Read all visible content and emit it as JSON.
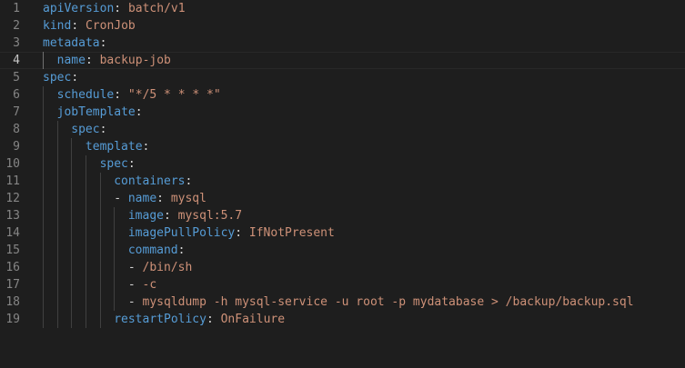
{
  "lines": [
    {
      "n": "1",
      "dash": "",
      "key": "apiVersion",
      "value": "batch/v1"
    },
    {
      "n": "2",
      "dash": "",
      "key": "kind",
      "value": "CronJob"
    },
    {
      "n": "3",
      "dash": "",
      "key": "metadata",
      "value": ""
    },
    {
      "n": "4",
      "dash": "",
      "key": "name",
      "value": "backup-job"
    },
    {
      "n": "5",
      "dash": "",
      "key": "spec",
      "value": ""
    },
    {
      "n": "6",
      "dash": "",
      "key": "schedule",
      "value": "\"*/5 * * * *\""
    },
    {
      "n": "7",
      "dash": "",
      "key": "jobTemplate",
      "value": ""
    },
    {
      "n": "8",
      "dash": "",
      "key": "spec",
      "value": ""
    },
    {
      "n": "9",
      "dash": "",
      "key": "template",
      "value": ""
    },
    {
      "n": "10",
      "dash": "",
      "key": "spec",
      "value": ""
    },
    {
      "n": "11",
      "dash": "",
      "key": "containers",
      "value": ""
    },
    {
      "n": "12",
      "dash": "- ",
      "key": "name",
      "value": "mysql"
    },
    {
      "n": "13",
      "dash": "",
      "key": "image",
      "value": "mysql:5.7"
    },
    {
      "n": "14",
      "dash": "",
      "key": "imagePullPolicy",
      "value": "IfNotPresent"
    },
    {
      "n": "15",
      "dash": "",
      "key": "command",
      "value": ""
    },
    {
      "n": "16",
      "dash": "- ",
      "key": "",
      "value": "/bin/sh"
    },
    {
      "n": "17",
      "dash": "- ",
      "key": "",
      "value": "-c"
    },
    {
      "n": "18",
      "dash": "- ",
      "key": "",
      "value": "mysqldump -h mysql-service -u root -p mydatabase > /backup/backup.sql"
    },
    {
      "n": "19",
      "dash": "",
      "key": "restartPolicy",
      "value": "OnFailure"
    }
  ]
}
